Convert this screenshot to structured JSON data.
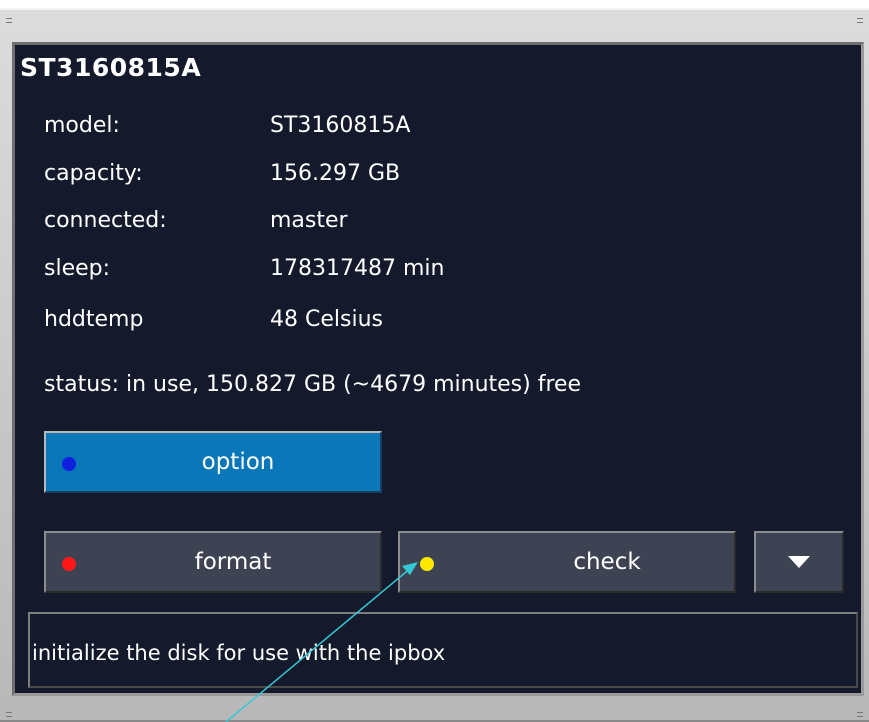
{
  "disk": {
    "title": "ST3160815A",
    "fields": [
      {
        "label": "model:",
        "value": "ST3160815A"
      },
      {
        "label": "capacity:",
        "value": "156.297 GB"
      },
      {
        "label": "connected:",
        "value": "master"
      },
      {
        "label": "sleep:",
        "value": "178317487 min"
      },
      {
        "label": "hddtemp",
        "value": "48  Celsius"
      }
    ],
    "status": "status:  in use, 150.827 GB (~4679 minutes) free"
  },
  "buttons": {
    "option": "option",
    "format": "format",
    "check": "check",
    "more_icon": "triangle-down-icon"
  },
  "help": {
    "text": "initialize the disk for use with the ipbox"
  },
  "colors": {
    "panel_bg": "#141a2c",
    "option_bg": "#0a78b8",
    "button_bg": "#3e4354",
    "dot_blue": "#1020e0",
    "dot_red": "#ff1818",
    "dot_yellow": "#ffe800",
    "pointer": "#35c9d6"
  }
}
